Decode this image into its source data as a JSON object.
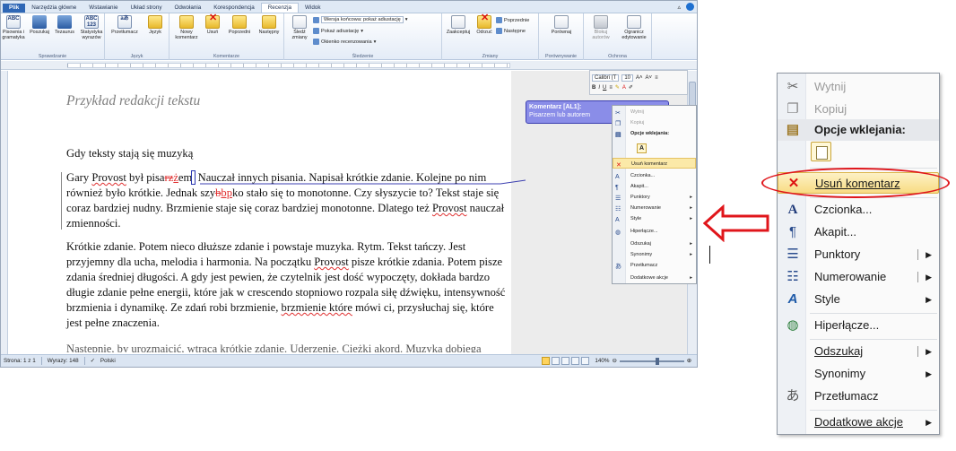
{
  "word": {
    "tabs": [
      "Plik",
      "Narzędzia główne",
      "Wstawianie",
      "Układ strony",
      "Odwołania",
      "Korespondencja",
      "Recenzja",
      "Widok"
    ],
    "active_tab": "Recenzja",
    "ribbon": {
      "groups": [
        {
          "name": "Sprawdzanie",
          "buttons": [
            "Pisownia i gramatyka",
            "Poszukaj",
            "Tezaurus",
            "Statystyka wyrazów"
          ]
        },
        {
          "name": "Język",
          "buttons": [
            "Przetłumacz",
            "Język"
          ]
        },
        {
          "name": "Komentarze",
          "buttons": [
            "Nowy komentarz",
            "Usuń",
            "Poprzedni",
            "Następny"
          ]
        },
        {
          "name": "Śledzenie",
          "buttons": [
            "Śledź zmiany"
          ],
          "display_for_review": "Wersja końcowa: pokaż adiustację",
          "show_markup": "Pokaż adiustację",
          "reviewing_pane": "Okienko recenzowania"
        },
        {
          "name": "Zmiany",
          "buttons": [
            "Zaakceptuj",
            "Odrzuć"
          ],
          "prev": "Poprzednie",
          "next": "Następne"
        },
        {
          "name": "Porównywanie",
          "buttons": [
            "Porównaj"
          ]
        },
        {
          "name": "Ochrona",
          "buttons": [
            "Blokuj autorów",
            "Ogranicz edytowanie"
          ]
        }
      ]
    },
    "document": {
      "title": "Przykład redakcji tekstu",
      "heading": "Gdy teksty stają się muzyką",
      "p1": {
        "s1": "Gary ",
        "w_provost1": "Provost",
        "s2": " był pisa",
        "del1": "rz",
        "ins1": "ż",
        "s3": "em",
        "s4": " Nauczał innych pisania. Napisał krótkie zdanie. Kolejne po nim również było krótkie. Jednak szy",
        "del2": "b",
        "ins2": "bp",
        "s5": "ko stało się to monotonne. Czy słyszycie to? Tekst staje się coraz bardziej nudny. Brzmienie staje się coraz bardziej monotonne.  Dlatego też ",
        "w_provost2": "Provost",
        "s6": " nauczał zmienności."
      },
      "p2": {
        "a": "Krótkie zdanie. Potem nieco dłuższe zdanie i powstaje muzyka. Rytm. Tekst tańczy. Jest przyjemny dla ucha, melodia i harmonia. Na początku ",
        "w_provost": "Provost",
        "b": " pisze krótkie zdania. Potem pisze zdania średniej długości. A gdy jest pewien, że czytelnik jest dość wypoczęty, dokłada bardzo długie zdanie pełne energii, które jak w crescendo stopniowo rozpala siłę dźwięku, intensywność brzmienia i dynamikę. Ze zdań robi brzmienie, ",
        "w_brzm": "brzmienie które",
        "c": " mówi ci, przysłuchaj się, które jest pełne znaczenia."
      },
      "p3": "Następnie, by urozmaicić, wtrąca krótkie zdanie. Uderzenie. Ciężki akord. Muzyka dobiega końca."
    },
    "comment": {
      "label": "Komentarz [AL1]:",
      "text": "Pisarzem lub autorem"
    },
    "mini_toolbar": {
      "font": "Calibri (T",
      "size": "10"
    },
    "small_menu": [
      "Wytnij",
      "Kopiuj",
      "Opcje wklejania:",
      "Usuń komentarz",
      "Czcionka...",
      "Akapit...",
      "Punktory",
      "Numerowanie",
      "Style",
      "Hiperłącze...",
      "Odszukaj",
      "Synonimy",
      "Przetłumacz",
      "Dodatkowe akcje"
    ],
    "status": {
      "page": "Strona: 1 z 1",
      "words": "Wyrazy: 148",
      "lang": "Polski",
      "zoom": "140%"
    }
  },
  "context_menu": {
    "cut": "Wytnij",
    "copy": "Kopiuj",
    "paste_options": "Opcje wklejania:",
    "delete_comment": "Usuń komentarz",
    "font": "Czcionka...",
    "paragraph": "Akapit...",
    "bullets": "Punktory",
    "numbering": "Numerowanie",
    "styles": "Style",
    "hyperlink": "Hiperłącze...",
    "lookup": "Odszukaj",
    "synonyms": "Synonimy",
    "translate": "Przetłumacz",
    "more_actions": "Dodatkowe akcje"
  },
  "colors": {
    "highlight_oval": "#e0161b",
    "arrow": "#e0161b",
    "balloon": "#8a8de8",
    "revision": "#e03030"
  }
}
